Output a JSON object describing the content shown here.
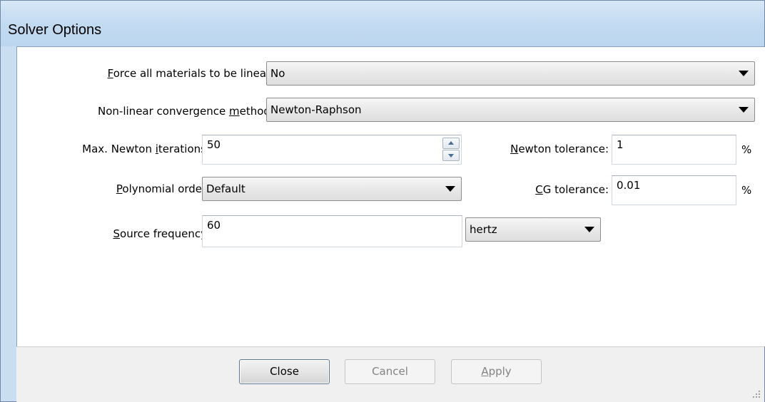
{
  "window": {
    "title": "Solver Options"
  },
  "fields": {
    "force_linear": {
      "label_key": "F",
      "label_rest": "orce all materials to be linear:",
      "value": "No"
    },
    "convergence": {
      "label_pre": "Non-linear convergence ",
      "label_key": "m",
      "label_post": "ethod:",
      "value": "Newton-Raphson"
    },
    "max_iterations": {
      "label_pre": "Max. Newton ",
      "label_key": "i",
      "label_post": "terations:",
      "value": "50"
    },
    "newton_tolerance": {
      "label_key": "N",
      "label_rest": "ewton tolerance:",
      "value": "1",
      "unit": "%"
    },
    "polynomial_order": {
      "label_key": "P",
      "label_rest": "olynomial order:",
      "value": "Default"
    },
    "cg_tolerance": {
      "label_key": "C",
      "label_rest": "G tolerance:",
      "value": "0.01",
      "unit": "%"
    },
    "source_frequency": {
      "label_key": "S",
      "label_rest": "ource frequency:",
      "value": "60",
      "unit_value": "hertz"
    }
  },
  "buttons": {
    "close": "Close",
    "cancel": "Cancel",
    "apply_key": "A",
    "apply_rest": "pply"
  }
}
